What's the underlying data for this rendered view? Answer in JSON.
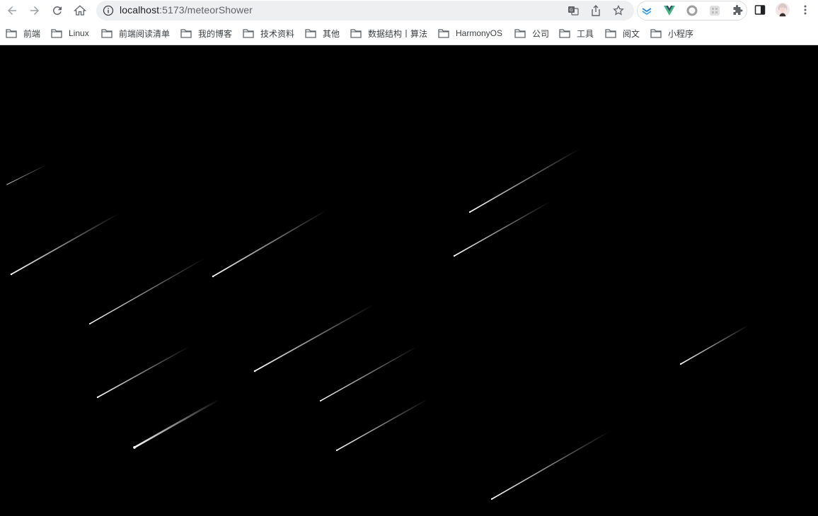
{
  "browser": {
    "url_host": "localhost",
    "url_path": ":5173/meteorShower",
    "icons": {
      "back": "arrow-left-icon",
      "forward": "arrow-right-icon",
      "reload": "reload-icon",
      "home": "home-icon",
      "site_info": "info-icon",
      "translate": "translate-icon",
      "share": "share-icon",
      "bookmark": "star-icon",
      "extensions": "puzzle-icon",
      "side_panel": "side-panel-icon",
      "menu": "kebab-menu-icon"
    }
  },
  "bookmarks": [
    {
      "label": "前端"
    },
    {
      "label": "Linux"
    },
    {
      "label": "前端阅读清单"
    },
    {
      "label": "我的博客"
    },
    {
      "label": "技术资料"
    },
    {
      "label": "其他"
    },
    {
      "label": "数据结构丨算法"
    },
    {
      "label": "HarmonyOS"
    },
    {
      "label": "公司"
    },
    {
      "label": "工具"
    },
    {
      "label": "阅文"
    },
    {
      "label": "小程序"
    }
  ],
  "page": {
    "background": "#000000",
    "meteor_color": "#ffffff"
  }
}
